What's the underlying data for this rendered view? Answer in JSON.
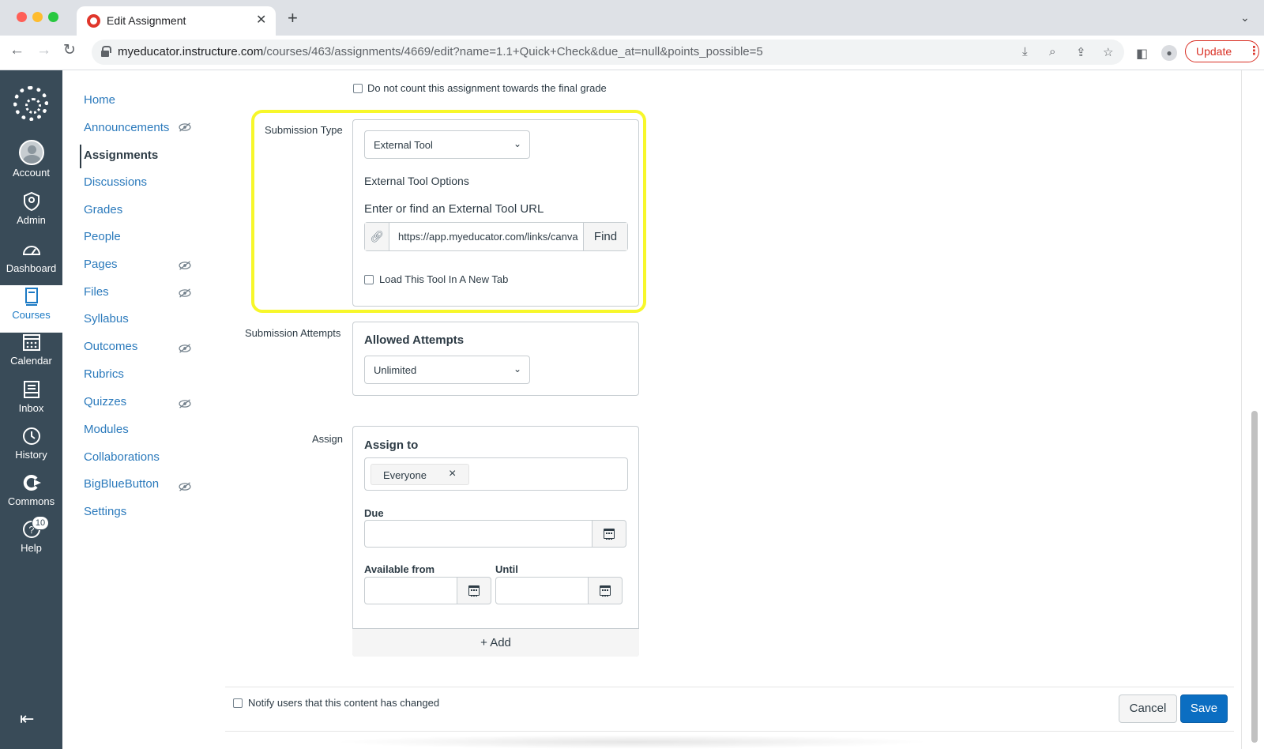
{
  "browser": {
    "tab_title": "Edit Assignment",
    "url_host": "myeducator.instructure.com",
    "url_path": "/courses/463/assignments/4669/edit?name=1.1+Quick+Check&due_at=null&points_possible=5",
    "update_label": "Update"
  },
  "global_nav": {
    "items": [
      {
        "label": "Account",
        "icon": "user-avatar-icon"
      },
      {
        "label": "Admin",
        "icon": "shield-icon"
      },
      {
        "label": "Dashboard",
        "icon": "gauge-icon"
      },
      {
        "label": "Courses",
        "icon": "book-icon"
      },
      {
        "label": "Calendar",
        "icon": "calendar-icon"
      },
      {
        "label": "Inbox",
        "icon": "inbox-icon"
      },
      {
        "label": "History",
        "icon": "clock-icon"
      },
      {
        "label": "Commons",
        "icon": "commons-icon"
      },
      {
        "label": "Help",
        "icon": "help-icon"
      }
    ],
    "help_badge": "10",
    "active": "Courses"
  },
  "course_nav": {
    "items": [
      {
        "label": "Home",
        "hidden_icon": false
      },
      {
        "label": "Announcements",
        "hidden_icon": true
      },
      {
        "label": "Assignments",
        "hidden_icon": false
      },
      {
        "label": "Discussions",
        "hidden_icon": false
      },
      {
        "label": "Grades",
        "hidden_icon": false
      },
      {
        "label": "People",
        "hidden_icon": false
      },
      {
        "label": "Pages",
        "hidden_icon": true
      },
      {
        "label": "Files",
        "hidden_icon": true
      },
      {
        "label": "Syllabus",
        "hidden_icon": false
      },
      {
        "label": "Outcomes",
        "hidden_icon": true
      },
      {
        "label": "Rubrics",
        "hidden_icon": false
      },
      {
        "label": "Quizzes",
        "hidden_icon": true
      },
      {
        "label": "Modules",
        "hidden_icon": false
      },
      {
        "label": "Collaborations",
        "hidden_icon": false
      },
      {
        "label": "BigBlueButton",
        "hidden_icon": true
      },
      {
        "label": "Settings",
        "hidden_icon": false
      }
    ],
    "active": "Assignments"
  },
  "form": {
    "no_count_label": "Do not count this assignment towards the final grade",
    "submission_type": {
      "label": "Submission Type",
      "selected": "External Tool",
      "options_heading": "External Tool Options",
      "url_heading": "Enter or find an External Tool URL",
      "url_value": "https://app.myeducator.com/links/canvas",
      "find_label": "Find",
      "new_tab_label": "Load This Tool In A New Tab"
    },
    "submission_attempts": {
      "label": "Submission Attempts",
      "heading": "Allowed Attempts",
      "selected": "Unlimited"
    },
    "assign": {
      "label": "Assign",
      "assign_to_heading": "Assign to",
      "token": "Everyone",
      "due_label": "Due",
      "available_from_label": "Available from",
      "until_label": "Until",
      "add_label": "Add"
    },
    "notify_label": "Notify users that this content has changed",
    "cancel_label": "Cancel",
    "save_label": "Save"
  },
  "colors": {
    "global_nav_bg": "#394b58",
    "link": "#2b7abc",
    "primary_button": "#0b6ec2",
    "highlight": "#f7f72a"
  }
}
